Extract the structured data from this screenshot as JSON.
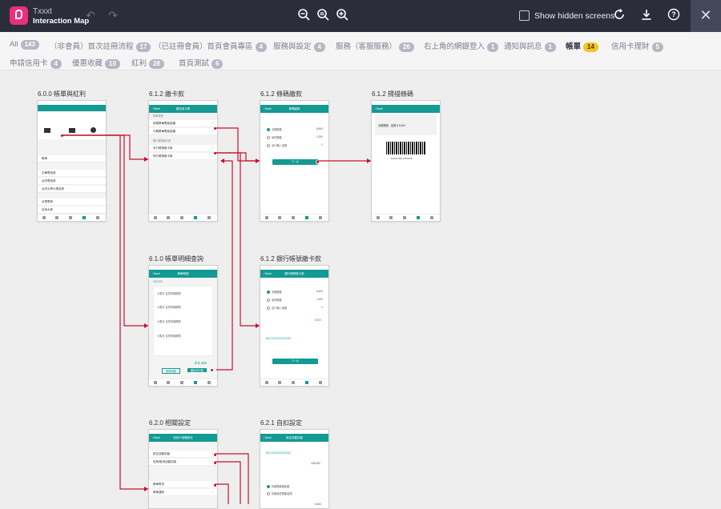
{
  "app": {
    "name": "Txxxt",
    "subtitle": "Interaction Map"
  },
  "toolbar": {
    "show_hidden_label": "Show hidden screens",
    "close_glyph": "✕"
  },
  "filters": [
    {
      "label": "All",
      "count": "143"
    },
    {
      "label": "（非會員）首次註冊流程",
      "count": "17"
    },
    {
      "label": "（已註冊會員）首頁會員專區",
      "count": "4"
    },
    {
      "label": "服務與設定",
      "count": "4"
    },
    {
      "label": "服務（客服服務）",
      "count": "26"
    },
    {
      "label": "右上角的網銀登入",
      "count": "1"
    },
    {
      "label": "通知與訊息",
      "count": "1"
    },
    {
      "label": "帳單",
      "count": "14",
      "active": true
    },
    {
      "label": "信用卡理財",
      "count": "5"
    },
    {
      "label": "申請信用卡",
      "count": "4"
    },
    {
      "label": "優惠收藏",
      "count": "10"
    },
    {
      "label": "紅利",
      "count": "28"
    },
    {
      "label": "首頁測試",
      "count": "6"
    }
  ],
  "screens": {
    "s1": {
      "title": "6.0.0 帳單與紅利",
      "r1": "帳單",
      "r2": "中華電信費",
      "r3": "台灣電信費",
      "r4": "台灣大哥大電信費",
      "r5": "台電電費",
      "r6": "自來水費"
    },
    "s2": {
      "title": "6.1.2 繳卡款",
      "nav": "繳信用卡款",
      "sec1": "帳單帳號",
      "r1": "前期帳單應繳金額",
      "r2": "今期帳單應繳金額",
      "sec2": "銀行帳號繳卡款",
      "r3": "本行帳號繳卡款",
      "r4": "他行帳號繳卡款"
    },
    "s3": {
      "title": "6.1.2 條碼繳款",
      "nav": "條碼繳款",
      "opt1": "全額應繳",
      "v1": "8,463",
      "opt2": "最低應繳",
      "v2": "1,200",
      "opt3": "自行輸入金額",
      "v3": "0",
      "btn": "下一步"
    },
    "s4": {
      "title": "6.1.2 掃描條碼",
      "line1": "全額應繳：金額 $ 8,463",
      "code": "BARCODE 00000000"
    },
    "s5": {
      "title": "6.1.0 帳單明細查詢",
      "nav": "帳單明細",
      "month": "2017/03",
      "item": "小馬可 百貨商場購物",
      "amt": "$ 8,456",
      "btn1": "帳單明細",
      "btn2": "繳信用卡款"
    },
    "s6": {
      "title": "6.1.2 銀行帳號繳卡款",
      "nav": "銀行帳號繳卡款",
      "opt1": "全額應繳",
      "v1": "8,463",
      "opt2": "最低應繳",
      "v2": "1,200",
      "opt3": "自行輸入金額",
      "v3": "0",
      "date": "09/23",
      "acct": "822-22222222222222",
      "btn": "下一步"
    },
    "s7": {
      "title": "6.2.0 相關設定",
      "nav": "信用卡相關設定",
      "r1": "設定自動扣繳",
      "r2": "查詢/取消自動扣繳",
      "r3": "帳單寄送",
      "r4": "帳單通知"
    },
    "s8": {
      "title": "6.2.1 自扣設定",
      "nav": "設定自動扣繳",
      "acct": "822-22222222222222",
      "v1": "148,899",
      "opt1": "扣繳應繳總金額",
      "opt2": "扣繳最低應繳金額",
      "v2": "8,463"
    }
  },
  "colors": {
    "brand": "#e8307b",
    "teal": "#139a93",
    "link": "#c8102e",
    "active_badge": "#f4c51f"
  }
}
